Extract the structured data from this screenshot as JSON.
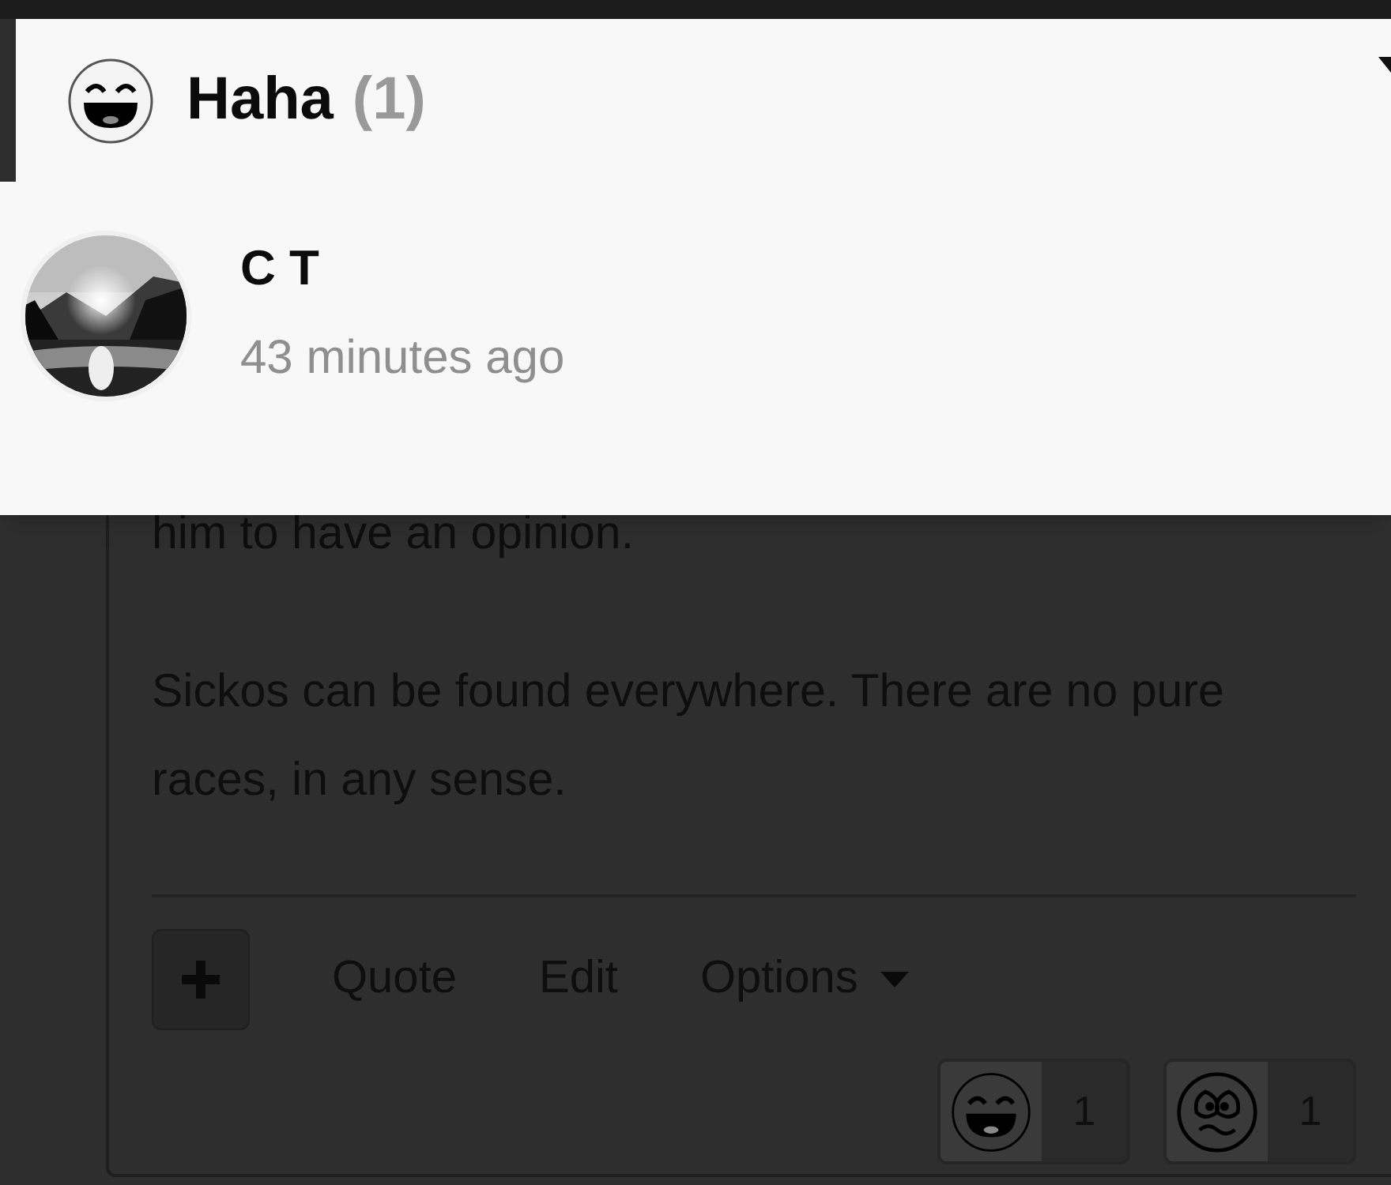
{
  "reactions_popup": {
    "title": "Haha",
    "count": "(1)",
    "users": [
      {
        "name": "C T",
        "time": "43 minutes ago"
      }
    ]
  },
  "post": {
    "paragraphs": [
      "him to have an opinion.",
      "Sickos can be found everywhere. There are no pure races, in any sense."
    ],
    "actions": [
      "Quote",
      "Edit",
      "Options"
    ],
    "reactions": [
      {
        "kind": "laugh",
        "count": "1"
      },
      {
        "kind": "worried",
        "count": "1"
      }
    ]
  }
}
